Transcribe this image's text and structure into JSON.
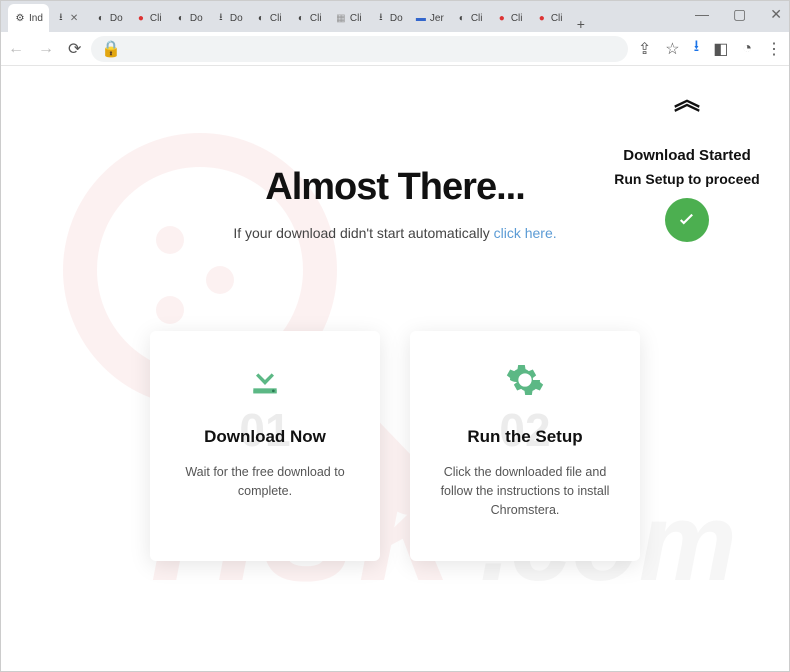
{
  "window": {
    "controls": {
      "min": "—",
      "max": "▢",
      "close": "✕"
    }
  },
  "tabs": [
    {
      "label": "Ind",
      "icon": "gear",
      "active": true
    },
    {
      "label": "",
      "icon": "download",
      "active": false,
      "close": true
    },
    {
      "label": "Do",
      "icon": "spinner",
      "active": false
    },
    {
      "label": "Cli",
      "icon": "red-dot",
      "active": false
    },
    {
      "label": "Do",
      "icon": "spinner",
      "active": false
    },
    {
      "label": "Do",
      "icon": "download",
      "active": false
    },
    {
      "label": "Cli",
      "icon": "spinner",
      "active": false
    },
    {
      "label": "Cli",
      "icon": "spinner",
      "active": false
    },
    {
      "label": "Cli",
      "icon": "gray",
      "active": false
    },
    {
      "label": "Do",
      "icon": "download",
      "active": false
    },
    {
      "label": "Jer",
      "icon": "blue",
      "active": false
    },
    {
      "label": "Cli",
      "icon": "spinner",
      "active": false
    },
    {
      "label": "Cli",
      "icon": "red-dot",
      "active": false
    },
    {
      "label": "Cli",
      "icon": "red-dot",
      "active": false
    }
  ],
  "newtab": "+",
  "toolbar": {
    "icons": {
      "back": "←",
      "forward": "→",
      "reload": "⟳",
      "lock": "🔒",
      "share": "⇪",
      "star": "☆",
      "download": "⭳",
      "ext": "◧",
      "profile": "◔",
      "menu": "⋮"
    }
  },
  "sidebar": {
    "chevron": "︽",
    "started": "Download Started",
    "proceed": "Run Setup to proceed"
  },
  "headline": {
    "title": "Almost There...",
    "sub_prefix": "If your download didn't start automatically ",
    "link": "click here."
  },
  "cards": [
    {
      "num": "01",
      "title": "Download Now",
      "body": "Wait for the free download to complete.",
      "icon": "download"
    },
    {
      "num": "02",
      "title": "Run the Setup",
      "body": "Click the downloaded file and follow the instructions to install Chromstera.",
      "icon": "gear"
    }
  ]
}
